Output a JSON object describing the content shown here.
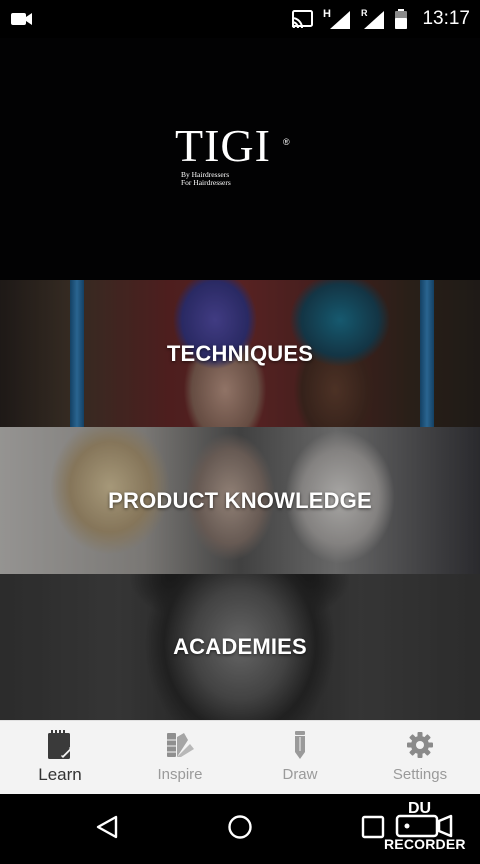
{
  "status_bar": {
    "network_label": "H",
    "roaming_label": "R",
    "time": "13:17",
    "icons": [
      "video-camera-icon",
      "cast-icon",
      "signal-icon",
      "signal-roaming-icon",
      "battery-icon"
    ]
  },
  "header": {
    "logo_text": "TIGI",
    "logo_registered": "®",
    "logo_tagline_line1": "By Hairdressers",
    "logo_tagline_line2": "For Hairdressers"
  },
  "tiles": [
    {
      "label": "TECHNIQUES"
    },
    {
      "label": "PRODUCT KNOWLEDGE"
    },
    {
      "label": "ACADEMIES"
    }
  ],
  "bottom_nav": {
    "active_index": 0,
    "items": [
      {
        "label": "Learn",
        "icon": "notebook-icon"
      },
      {
        "label": "Inspire",
        "icon": "swatches-icon"
      },
      {
        "label": "Draw",
        "icon": "pencil-icon"
      },
      {
        "label": "Settings",
        "icon": "gear-icon"
      }
    ]
  },
  "system_nav": {
    "icons": [
      "back-icon",
      "home-icon",
      "recents-icon"
    ]
  },
  "recorder_overlay": {
    "line1": "DU",
    "line2": "RECORDER"
  },
  "colors": {
    "header_bg": "#020203",
    "nav_bg": "#f3f3f3",
    "nav_active": "#333333",
    "nav_inactive": "#9a9a9a"
  }
}
